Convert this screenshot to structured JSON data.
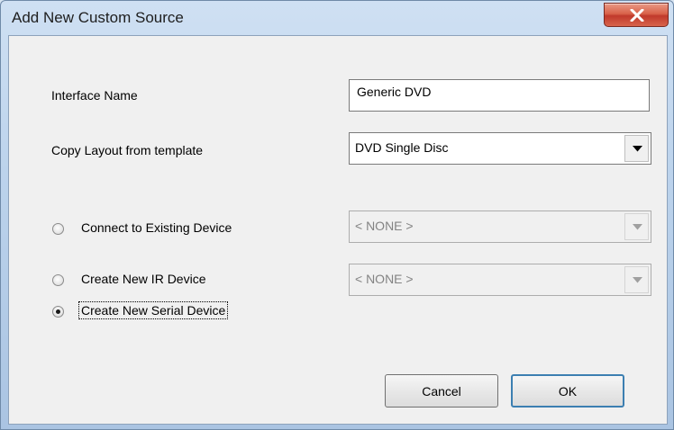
{
  "window": {
    "title": "Add New Custom Source",
    "close_icon": "close-icon"
  },
  "form": {
    "interface_name_label": "Interface Name",
    "interface_name_value": "Generic DVD",
    "copy_layout_label": "Copy Layout from template",
    "copy_layout_value": "DVD Single Disc",
    "options": [
      {
        "label": "Connect to Existing Device",
        "selected": false,
        "dropdown": "< NONE >"
      },
      {
        "label": "Create New IR Device",
        "selected": false,
        "dropdown": "< NONE >"
      },
      {
        "label": "Create New Serial Device",
        "selected": true
      }
    ]
  },
  "buttons": {
    "cancel": "Cancel",
    "ok": "OK"
  }
}
